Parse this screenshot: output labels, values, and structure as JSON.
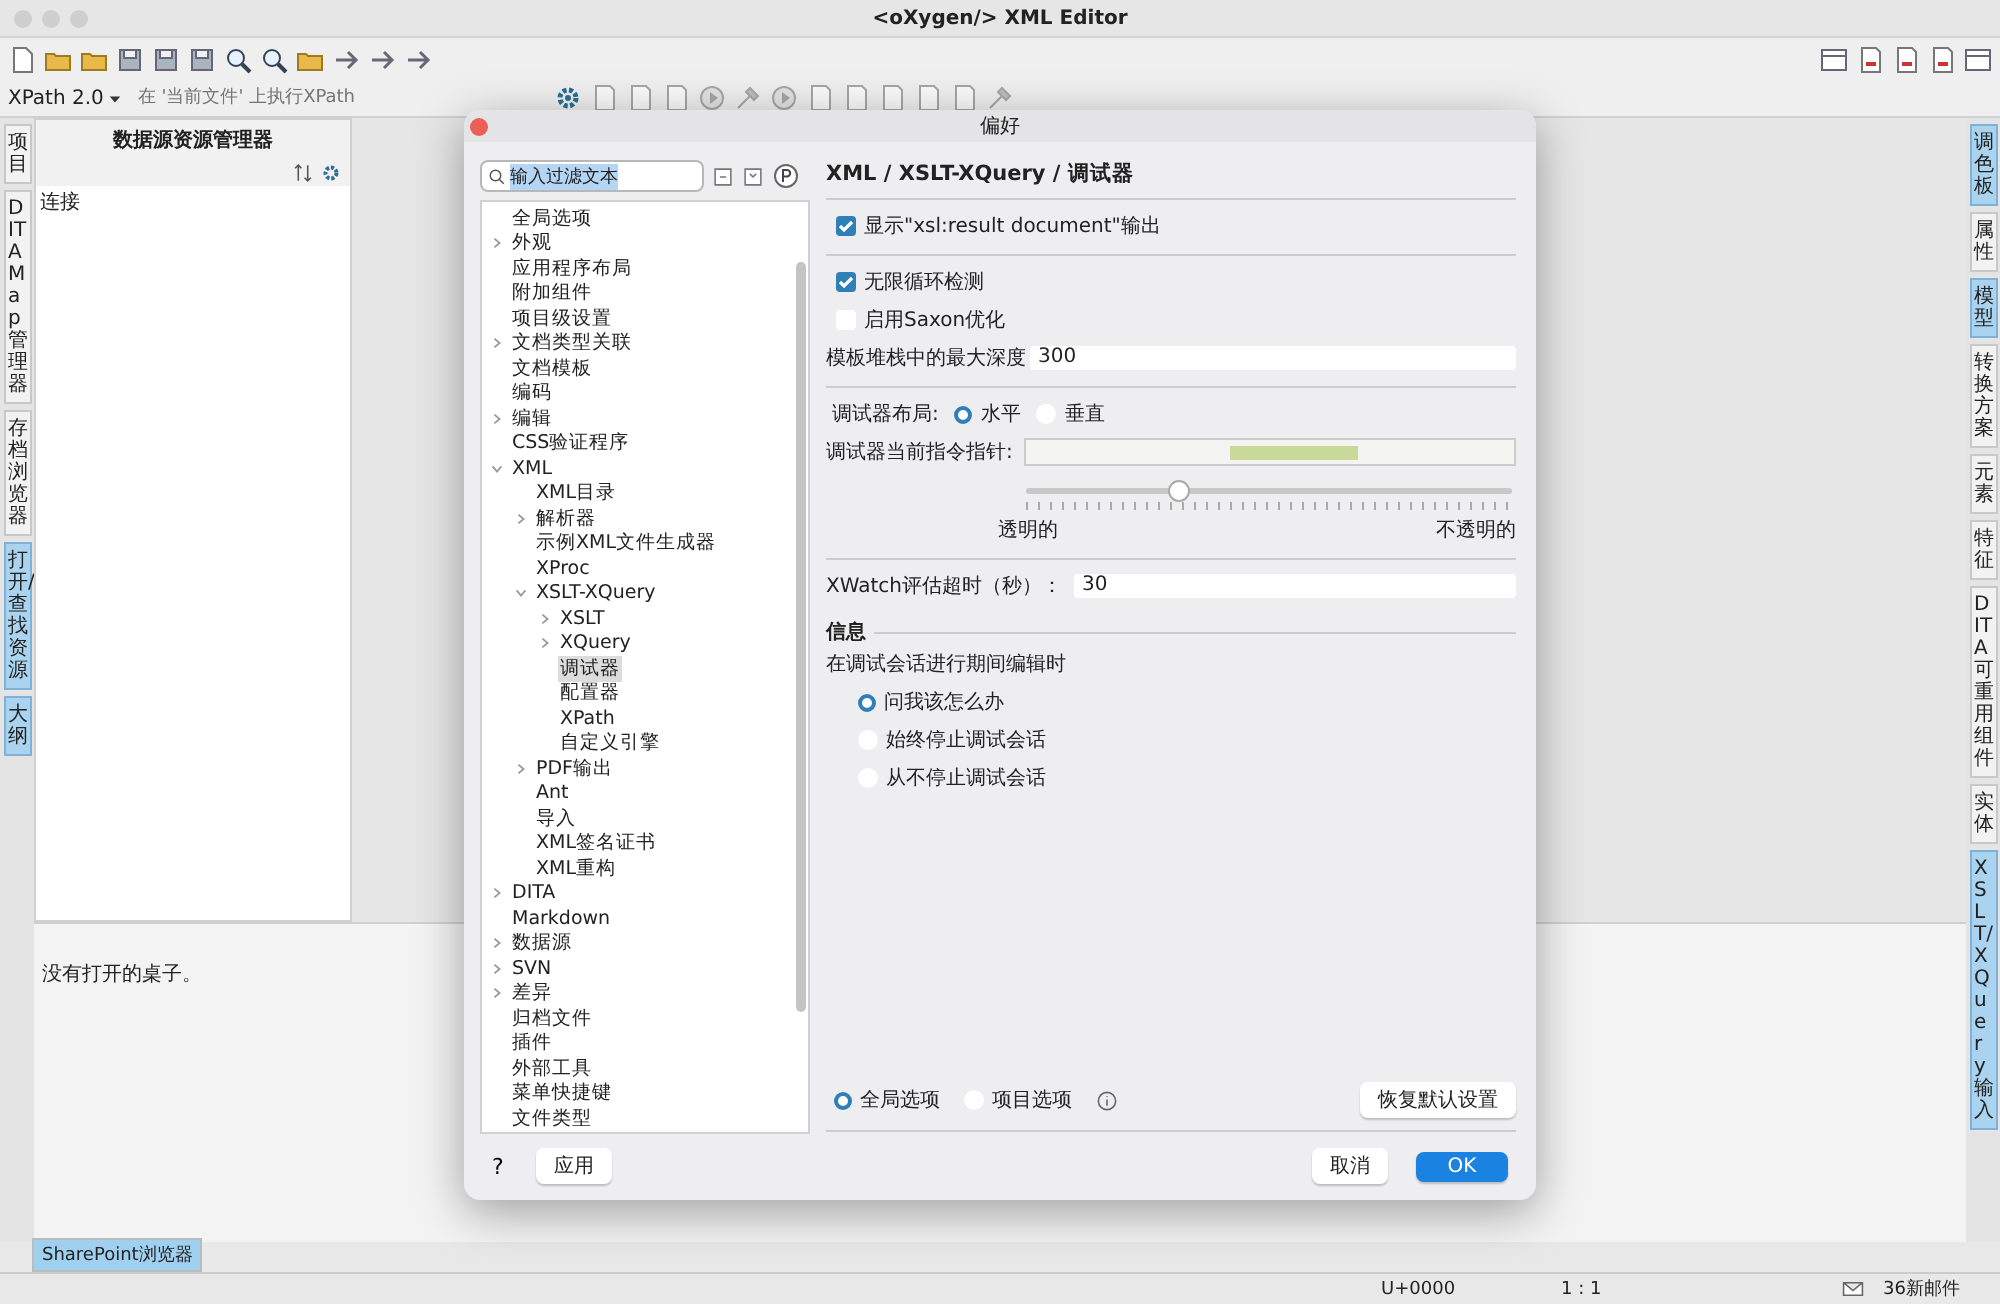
{
  "window": {
    "title": "<oXygen/> XML Editor"
  },
  "xpath_bar": {
    "version": "XPath 2.0",
    "placeholder": "在 '当前文件' 上执行XPath"
  },
  "left_tabs": [
    {
      "label": "项目",
      "selected": false
    },
    {
      "label": "DITA Map 管理器",
      "selected": false
    },
    {
      "label": "存档浏览器",
      "selected": false
    },
    {
      "label": "打开/查找资源",
      "selected": true
    },
    {
      "label": "大纲",
      "selected": true
    }
  ],
  "panel": {
    "title": "数据源资源管理器",
    "items": [
      "连接"
    ]
  },
  "bottom_panel": {
    "message": "没有打开的桌子。"
  },
  "bottom_tabs": [
    {
      "label": "SharePoint浏览器",
      "selected": true
    }
  ],
  "right_tabs": [
    {
      "label": "调色板",
      "selected": true
    },
    {
      "label": "属性",
      "selected": false
    },
    {
      "label": "模型",
      "selected": true
    },
    {
      "label": "转换方案",
      "selected": false
    },
    {
      "label": "元素",
      "selected": false
    },
    {
      "label": "特征",
      "selected": false
    },
    {
      "label": "DITA可重用组件",
      "selected": false
    },
    {
      "label": "实体",
      "selected": false
    },
    {
      "label": "XSLT/XQuery输入",
      "selected": true
    }
  ],
  "status_bar": [
    "U+0000",
    "1 : 1",
    "36新邮件"
  ],
  "dialog": {
    "title": "偏好",
    "filter": "输入过滤文本",
    "tree": [
      {
        "label": "全局选项",
        "selected": false
      },
      {
        "label": "外观",
        "selected": false,
        "expanded": false
      },
      {
        "label": "应用程序布局",
        "selected": false
      },
      {
        "label": "附加组件",
        "selected": false
      },
      {
        "label": "项目级设置",
        "selected": false
      },
      {
        "label": "文档类型关联",
        "selected": false,
        "expanded": false
      },
      {
        "label": "文档模板",
        "selected": false
      },
      {
        "label": "编码",
        "selected": false
      },
      {
        "label": "编辑",
        "selected": false,
        "expanded": false
      },
      {
        "label": "CSS验证程序",
        "selected": false
      },
      {
        "label": "XML",
        "selected": false,
        "expanded": true,
        "children": [
          {
            "label": "XML目录",
            "selected": false
          },
          {
            "label": "解析器",
            "selected": false,
            "expanded": false
          },
          {
            "label": "示例XML文件生成器",
            "selected": false
          },
          {
            "label": "XProc",
            "selected": false
          },
          {
            "label": "XSLT-XQuery",
            "selected": false,
            "expanded": true,
            "children": [
              {
                "label": "XSLT",
                "selected": false,
                "expanded": false
              },
              {
                "label": "XQuery",
                "selected": false,
                "expanded": false
              },
              {
                "label": "调试器",
                "selected": true
              },
              {
                "label": "配置器",
                "selected": false
              },
              {
                "label": "XPath",
                "selected": false
              },
              {
                "label": "自定义引擎",
                "selected": false
              }
            ]
          },
          {
            "label": "PDF输出",
            "selected": false,
            "expanded": false
          },
          {
            "label": "Ant",
            "selected": false
          },
          {
            "label": "导入",
            "selected": false
          },
          {
            "label": "XML签名证书",
            "selected": false
          },
          {
            "label": "XML重构",
            "selected": false
          }
        ]
      },
      {
        "label": "DITA",
        "selected": false,
        "expanded": false
      },
      {
        "label": "Markdown",
        "selected": false
      },
      {
        "label": "数据源",
        "selected": false,
        "expanded": false
      },
      {
        "label": "SVN",
        "selected": false,
        "expanded": false
      },
      {
        "label": "差异",
        "selected": false,
        "expanded": false
      },
      {
        "label": "归档文件",
        "selected": false
      },
      {
        "label": "插件",
        "selected": false
      },
      {
        "label": "外部工具",
        "selected": false
      },
      {
        "label": "菜单快捷键",
        "selected": false
      },
      {
        "label": "文件类型",
        "selected": false
      }
    ],
    "breadcrumb": "XML / XSLT-XQuery / 调试器",
    "show_result_document": {
      "label": "显示\"xsl:result document\"输出",
      "checked": true
    },
    "loop_detection": {
      "label": "无限循环检测",
      "checked": true
    },
    "saxon_optimization": {
      "label": "启用Saxon优化",
      "checked": false
    },
    "max_stack_depth": {
      "label": "模板堆栈中的最大深度",
      "value": "300"
    },
    "layout": {
      "label": "调试器布局:",
      "options": [
        {
          "label": "水平",
          "selected": true
        },
        {
          "label": "垂直",
          "selected": false
        }
      ]
    },
    "pointer_color": {
      "label": "调试器当前指令指针:",
      "color": "#c9d99a"
    },
    "transparency": {
      "level": 0.31,
      "min_label": "透明的",
      "max_label": "不透明的"
    },
    "xwatch_timeout": {
      "label": "XWatch评估超时（秒）：",
      "value": "30"
    },
    "info": {
      "title": "信息",
      "subtitle": "在调试会话进行期间编辑时",
      "options": [
        {
          "label": "问我该怎么办",
          "selected": true
        },
        {
          "label": "始终停止调试会话",
          "selected": false
        },
        {
          "label": "从不停止调试会话",
          "selected": false
        }
      ]
    },
    "scope": [
      {
        "label": "全局选项",
        "selected": true
      },
      {
        "label": "项目选项",
        "selected": false
      }
    ],
    "restore_button": "恢复默认设置",
    "help_button": "?",
    "apply_button": "应用",
    "cancel_button": "取消",
    "ok_button": "OK"
  }
}
